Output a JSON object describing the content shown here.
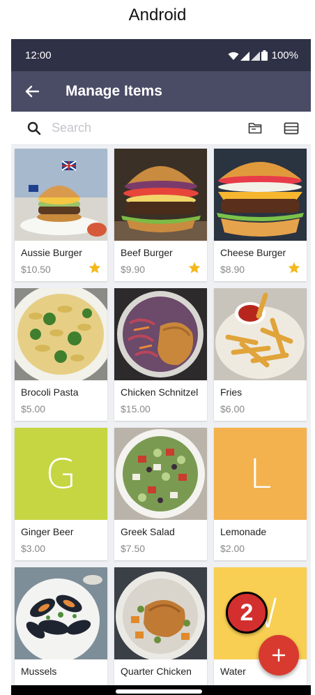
{
  "caption": "Android",
  "status_bar": {
    "time": "12:00",
    "battery": "100%"
  },
  "app_bar": {
    "title": "Manage Items",
    "back_icon": "arrow-back-icon"
  },
  "search": {
    "placeholder": "Search",
    "value": "",
    "icon": "search-icon"
  },
  "toolbar": {
    "folder_icon": "folder-icon",
    "list_view_icon": "list-view-icon"
  },
  "items": [
    {
      "name": "Aussie Burger",
      "price": "$10.50",
      "favorite": true,
      "thumb": "burger-photo"
    },
    {
      "name": "Beef Burger",
      "price": "$9.90",
      "favorite": true,
      "thumb": "burger-photo"
    },
    {
      "name": "Cheese Burger",
      "price": "$8.90",
      "favorite": true,
      "thumb": "burger-photo"
    },
    {
      "name": "Brocoli Pasta",
      "price": "$5.00",
      "favorite": false,
      "thumb": "pasta-photo"
    },
    {
      "name": "Chicken Schnitzel",
      "price": "$15.00",
      "favorite": false,
      "thumb": "schnitzel-photo"
    },
    {
      "name": "Fries",
      "price": "$6.00",
      "favorite": false,
      "thumb": "fries-photo"
    },
    {
      "name": "Ginger Beer",
      "price": "$3.00",
      "favorite": false,
      "letter": "G",
      "color": "#c5d642"
    },
    {
      "name": "Greek Salad",
      "price": "$7.50",
      "favorite": false,
      "thumb": "salad-photo"
    },
    {
      "name": "Lemonade",
      "price": "$2.00",
      "favorite": false,
      "letter": "L",
      "color": "#f3b24e"
    },
    {
      "name": "Mussels",
      "price": "",
      "favorite": false,
      "thumb": "mussels-photo"
    },
    {
      "name": "Quarter Chicken",
      "price": "",
      "favorite": false,
      "thumb": "chicken-photo"
    },
    {
      "name": "Water",
      "price": "",
      "favorite": false,
      "letter": "W",
      "color": "#f8cf52"
    }
  ],
  "step_badge": "2",
  "fab": {
    "icon": "plus-icon"
  },
  "colors": {
    "status_bar": "#2f3246",
    "app_bar": "#4a4c66",
    "accent": "#d93a2f",
    "star": "#f5b81c"
  }
}
